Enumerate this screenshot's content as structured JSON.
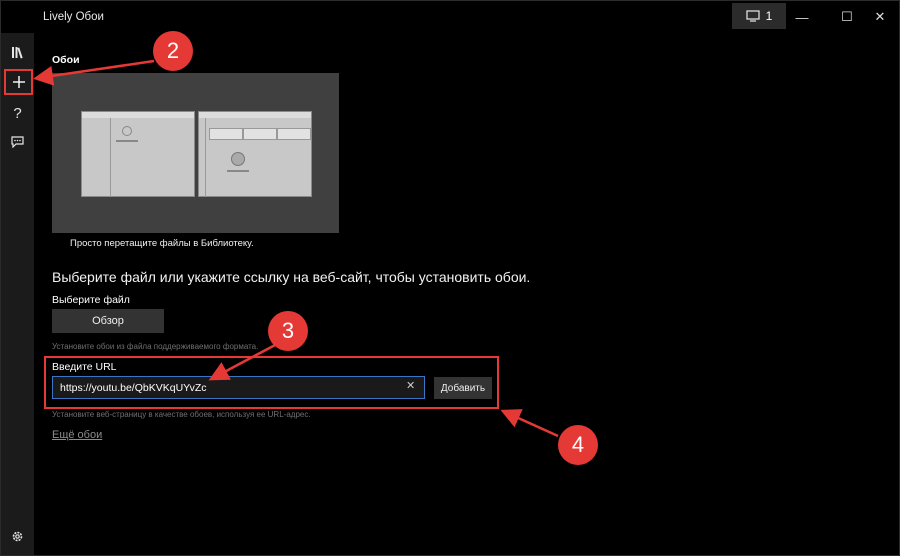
{
  "window": {
    "title": "Lively Обои"
  },
  "titlebar": {
    "monitor_count": "1",
    "minimize_glyph": "—",
    "maximize_glyph": "☐",
    "close_glyph": "✕"
  },
  "sidebar": {
    "items": [
      {
        "icon": "library-icon"
      },
      {
        "icon": "plus-icon"
      },
      {
        "icon": "help-icon",
        "glyph": "?"
      },
      {
        "icon": "feedback-icon"
      },
      {
        "icon": "gear-icon"
      }
    ]
  },
  "main": {
    "section_title": "Обои",
    "preview_caption": "Просто перетащите файлы в Библиотеку.",
    "heading": "Выберите файл или укажите ссылку на веб-сайт, чтобы установить обои.",
    "choose_file_label": "Выберите файл",
    "browse_button": "Обзор",
    "file_hint": "Установите обои из файла поддерживаемого формата.",
    "url_label": "Введите URL",
    "url_value": "https://youtu.be/QbKVKqUYvZc",
    "clear_glyph": "✕",
    "add_button": "Добавить",
    "url_hint": "Установите веб-страницу в качестве обоев, используя ее URL-адрес.",
    "more_link": "Ещё обои"
  },
  "annotations": [
    {
      "number": "2"
    },
    {
      "number": "3"
    },
    {
      "number": "4"
    }
  ],
  "colors": {
    "accent_red": "#e53935",
    "input_border": "#3a76c4",
    "background": "#000000"
  }
}
